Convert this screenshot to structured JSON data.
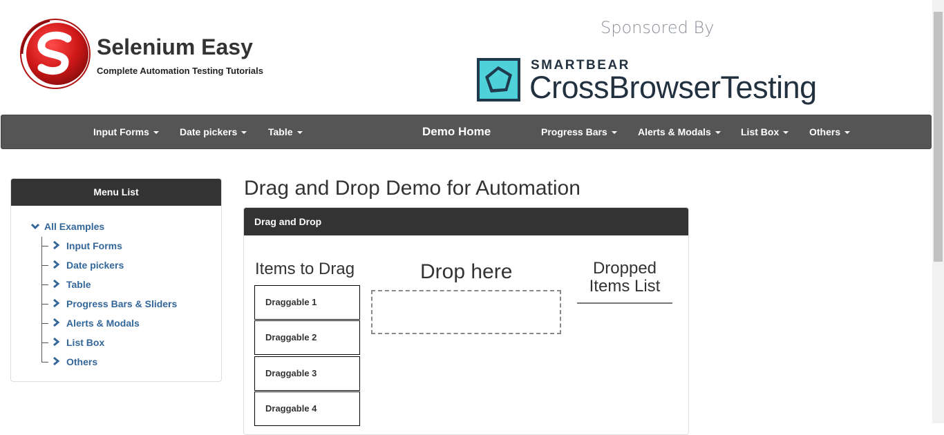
{
  "header": {
    "brand_title": "Selenium Easy",
    "brand_subtitle": "Complete Automation Testing Tutorials",
    "logo_icon": "selenium-easy-s-logo",
    "sponsored_label": "Sponsored By",
    "sponsor_small": "SMARTBEAR",
    "sponsor_big": "CrossBrowserTesting",
    "sponsor_icon": "crossbrowsertesting-logo"
  },
  "navbar": {
    "items_left": [
      {
        "label": "Input Forms"
      },
      {
        "label": "Date pickers"
      },
      {
        "label": "Table"
      }
    ],
    "home": "Demo Home",
    "items_right": [
      {
        "label": "Progress Bars"
      },
      {
        "label": "Alerts & Modals"
      },
      {
        "label": "List Box"
      },
      {
        "label": "Others"
      }
    ]
  },
  "sidebar": {
    "title": "Menu List",
    "root": "All Examples",
    "items": [
      {
        "label": "Input Forms"
      },
      {
        "label": "Date pickers"
      },
      {
        "label": "Table"
      },
      {
        "label": "Progress Bars & Sliders"
      },
      {
        "label": "Alerts & Modals"
      },
      {
        "label": "List Box"
      },
      {
        "label": "Others"
      }
    ]
  },
  "main": {
    "heading": "Drag and Drop Demo for Automation",
    "panel_title": "Drag and Drop",
    "items_title": "Items to Drag",
    "draggables": [
      {
        "label": "Draggable 1"
      },
      {
        "label": "Draggable 2"
      },
      {
        "label": "Draggable 3"
      },
      {
        "label": "Draggable 4"
      }
    ],
    "drop_title": "Drop here",
    "dropped_title": "Dropped Items List"
  },
  "colors": {
    "navbar_bg": "#555555",
    "panel_head_bg": "#333333",
    "link": "#336699",
    "logo_red": "#c8102e",
    "sponsor_teal": "#4fd1d9"
  }
}
